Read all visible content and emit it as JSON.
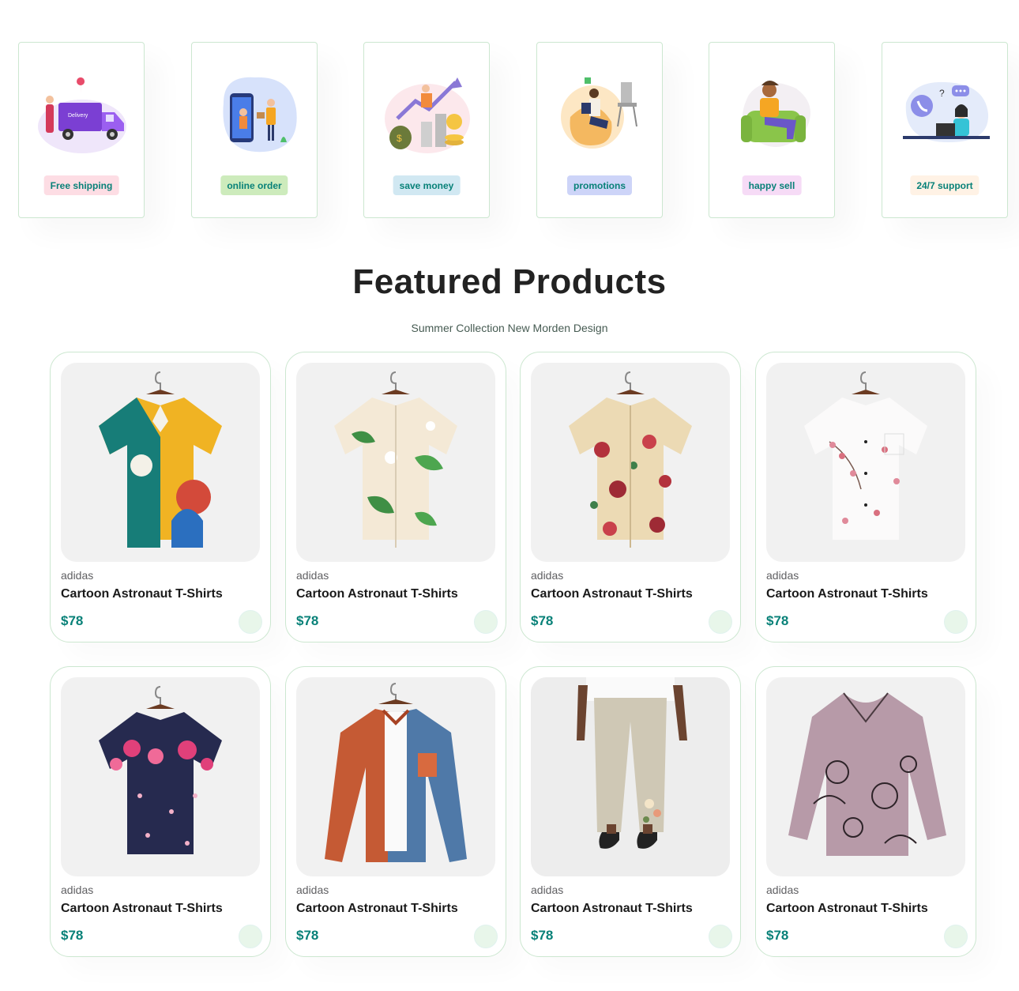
{
  "features": [
    {
      "label": "Free shipping",
      "icon": "delivery-truck-illustration",
      "bg": "#fddde4"
    },
    {
      "label": "online order",
      "icon": "phone-order-illustration",
      "bg": "#cdebbc"
    },
    {
      "label": "save money",
      "icon": "money-growth-illustration",
      "bg": "#d1e8f2"
    },
    {
      "label": "promotions",
      "icon": "promotion-reading-illustration",
      "bg": "#cdd4f8"
    },
    {
      "label": "happy sell",
      "icon": "happy-customer-illustration",
      "bg": "#f6dbf6"
    },
    {
      "label": "24/7 support",
      "icon": "support-agent-illustration",
      "bg": "#fff2e5"
    }
  ],
  "featured": {
    "title": "Featured Products",
    "subtitle": "Summer Collection New Morden Design"
  },
  "products": [
    {
      "brand": "adidas",
      "name": "Cartoon Astronaut T-Shirts",
      "price": "$78",
      "image": "abstract-print-shirt"
    },
    {
      "brand": "adidas",
      "name": "Cartoon Astronaut T-Shirts",
      "price": "$78",
      "image": "tropical-leaf-shirt"
    },
    {
      "brand": "adidas",
      "name": "Cartoon Astronaut T-Shirts",
      "price": "$78",
      "image": "floral-beige-shirt"
    },
    {
      "brand": "adidas",
      "name": "Cartoon Astronaut T-Shirts",
      "price": "$78",
      "image": "cherry-blossom-white-shirt"
    },
    {
      "brand": "adidas",
      "name": "Cartoon Astronaut T-Shirts",
      "price": "$78",
      "image": "navy-floral-shirt"
    },
    {
      "brand": "adidas",
      "name": "Cartoon Astronaut T-Shirts",
      "price": "$78",
      "image": "color-block-overshirt"
    },
    {
      "brand": "adidas",
      "name": "Cartoon Astronaut T-Shirts",
      "price": "$78",
      "image": "linen-trousers"
    },
    {
      "brand": "adidas",
      "name": "Cartoon Astronaut T-Shirts",
      "price": "$78",
      "image": "cat-print-blouse"
    }
  ],
  "colors": {
    "accent": "#088178",
    "cart_bg": "#e8f6ea",
    "card_border": "#cce7d0"
  }
}
